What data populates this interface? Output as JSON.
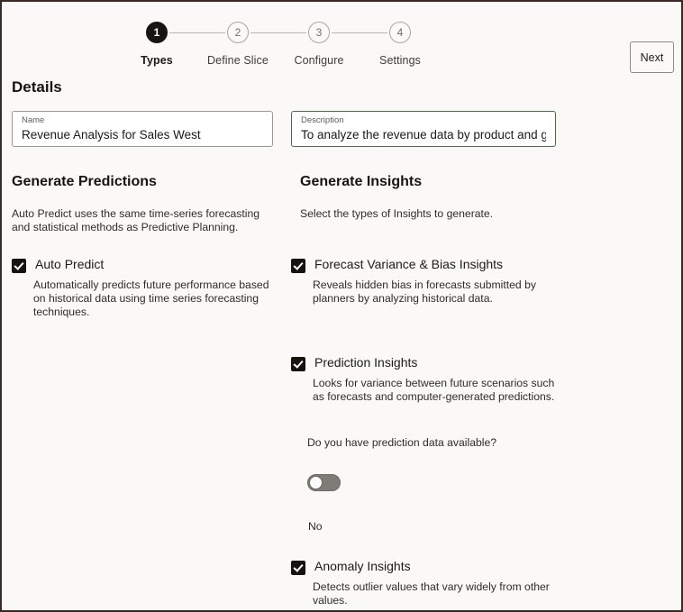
{
  "stepper": {
    "steps": [
      {
        "number": "1",
        "label": "Types",
        "state": "active"
      },
      {
        "number": "2",
        "label": "Define Slice",
        "state": "inactive"
      },
      {
        "number": "3",
        "label": "Configure",
        "state": "inactive"
      },
      {
        "number": "4",
        "label": "Settings",
        "state": "inactive"
      }
    ]
  },
  "header": {
    "next_label": "Next"
  },
  "details": {
    "title": "Details",
    "name_field": {
      "label": "Name",
      "value": "Revenue Analysis for Sales West"
    },
    "description_field": {
      "label": "Description",
      "value": "To analyze the revenue data by product and ge"
    }
  },
  "predictions": {
    "title": "Generate Predictions",
    "description": "Auto Predict uses the same time-series forecasting and statistical methods as Predictive Planning.",
    "options": [
      {
        "label": "Auto Predict",
        "checked": true,
        "help": "Automatically predicts future performance based on historical data using time series forecasting techniques."
      }
    ]
  },
  "insights": {
    "title": "Generate Insights",
    "description": "Select the types of Insights to generate.",
    "options": [
      {
        "label": "Forecast Variance & Bias Insights",
        "checked": true,
        "help": "Reveals hidden bias in forecasts submitted by planners by analyzing historical data."
      },
      {
        "label": "Prediction Insights",
        "checked": true,
        "help": "Looks for variance between future scenarios such as forecasts and computer-generated predictions."
      },
      {
        "label": "Anomaly Insights",
        "checked": true,
        "help": "Detects outlier values that vary widely from other values."
      }
    ],
    "prediction_data_question": "Do you have prediction data available?",
    "prediction_data_toggle_state": "No"
  },
  "colors": {
    "page_background": "#faf9f7",
    "window_border": "#3a2a26",
    "active_step": "#161513",
    "focus_border": "#4c6b4a",
    "toggle_off_track": "#7f7b76"
  }
}
